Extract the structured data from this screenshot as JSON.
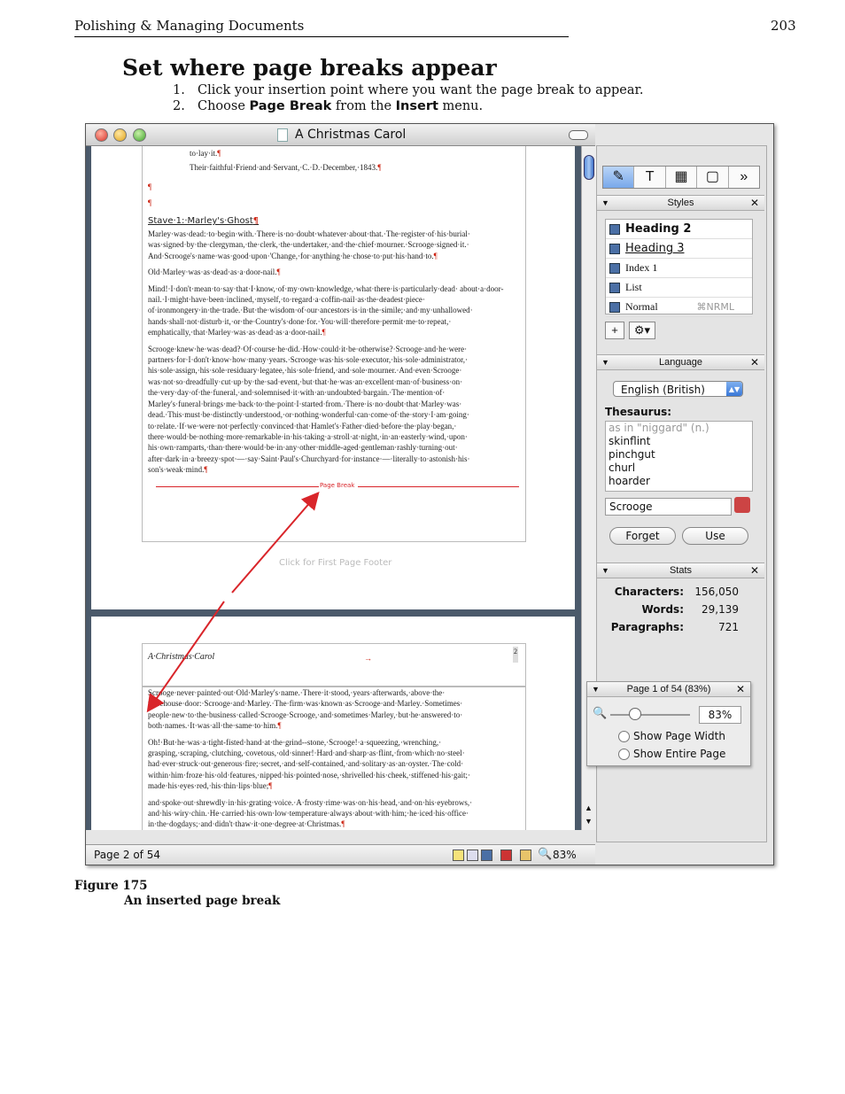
{
  "header": {
    "running_title": "Polishing & Managing Documents",
    "page_number": "203"
  },
  "section": {
    "heading": "Set where page breaks appear",
    "steps": [
      {
        "num": "1.",
        "text": "Click your insertion point where you want the page break to appear."
      },
      {
        "num": "2.",
        "pre": "Choose ",
        "b1": "Page Break",
        "mid": " from the ",
        "b2": "Insert",
        "post": " menu."
      }
    ]
  },
  "window": {
    "title": "A Christmas Carol"
  },
  "document": {
    "page1_top_lines": [
      "to·lay·it.",
      "Their·faithful·Friend·and·Servant,·C.·D.·December,·1843."
    ],
    "pilcrow": "¶",
    "stave_heading": "Stave·1:·Marley's·Ghost",
    "page1_paragraphs": [
      "Marley·was·dead:·to·begin·with.·There·is·no·doubt·whatever·about·that.·The·register·of·his·burial· was·signed·by·the·clergyman,·the·clerk,·the·undertaker,·and·the·chief·mourner.·Scrooge·signed·it.· And·Scrooge's·name·was·good·upon·'Change,·for·anything·he·chose·to·put·his·hand·to.",
      "Old·Marley·was·as·dead·as·a·door-nail.",
      "Mind!·I·don't·mean·to·say·that·I·know,·of·my·own·knowledge,·what·there·is·particularly·dead· about·a·door-nail.·I·might·have·been·inclined,·myself,·to·regard·a·coffin-nail·as·the·deadest·piece· of·ironmongery·in·the·trade.·But·the·wisdom·of·our·ancestors·is·in·the·simile;·and·my·unhallowed· hands·shall·not·disturb·it,·or·the·Country's·done·for.·You·will·therefore·permit·me·to·repeat,· emphatically,·that·Marley·was·as·dead·as·a·door-nail.",
      "Scrooge·knew·he·was·dead?·Of·course·he·did.·How·could·it·be·otherwise?·Scrooge·and·he·were· partners·for·I·don't·know·how·many·years.·Scrooge·was·his·sole·executor,·his·sole·administrator,· his·sole·assign,·his·sole·residuary·legatee,·his·sole·friend,·and·sole·mourner.·And·even·Scrooge· was·not·so·dreadfully·cut·up·by·the·sad·event,·but·that·he·was·an·excellent·man·of·business·on· the·very·day·of·the·funeral,·and·solemnised·it·with·an·undoubted·bargain.·The·mention·of· Marley's·funeral·brings·me·back·to·the·point·I·started·from.·There·is·no·doubt·that·Marley·was· dead.·This·must·be·distinctly·understood,·or·nothing·wonderful·can·come·of·the·story·I·am·going· to·relate.·If·we·were·not·perfectly·convinced·that·Hamlet's·Father·died·before·the·play·began,· there·would·be·nothing·more·remarkable·in·his·taking·a·stroll·at·night,·in·an·easterly·wind,·upon· his·own·ramparts,·than·there·would·be·in·any·other·middle-aged·gentleman·rashly·turning·out· after·dark·in·a·breezy·spot·—·say·Saint·Paul's·Churchyard·for·instance·—·literally·to·astonish·his· son's·weak·mind."
    ],
    "page_break_label": "Page Break",
    "footer_placeholder": "Click for First Page Footer",
    "page2_header": "A·Christmas·Carol",
    "page2_header_tab": "→",
    "page2_header_num": "2",
    "page2_paragraphs": [
      "Scrooge·never·painted·out·Old·Marley's·name.·There·it·stood,·years·afterwards,·above·the· warehouse·door:·Scrooge·and·Marley.·The·firm·was·known·as·Scrooge·and·Marley.·Sometimes· people·new·to·the·business·called·Scrooge·Scrooge,·and·sometimes·Marley,·but·he·answered·to· both·names.·It·was·all·the·same·to·him.",
      "Oh!·But·he·was·a·tight-fisted·hand·at·the·grind--stone,·Scrooge!·a·squeezing,·wrenching,· grasping,·scraping,·clutching,·covetous,·old·sinner!·Hard·and·sharp·as·flint,·from·which·no·steel· had·ever·struck·out·generous·fire;·secret,·and·self-contained,·and·solitary·as·an·oyster.·The·cold· within·him·froze·his·old·features,·nipped·his·pointed·nose,·shrivelled·his·cheek,·stiffened·his·gait;· made·his·eyes·red,·his·thin·lips·blue;",
      "and·spoke·out·shrewdly·in·his·grating·voice.·A·frosty·rime·was·on·his·head,·and·on·his·eyebrows,· and·his·wiry·chin.·He·carried·his·own·low·temperature·always·about·with·him;·he·iced·his·office· in·the·dogdays;·and·didn't·thaw·it·one·degree·at·Christmas."
    ]
  },
  "status_bar": {
    "page": "Page 2 of 54",
    "zoom": "83%"
  },
  "inspector": {
    "tabs": [
      "✎",
      "T",
      "▦",
      "▢",
      "»"
    ],
    "styles": {
      "title": "Styles",
      "items": [
        {
          "label": "Heading 2",
          "shortcut": ""
        },
        {
          "label": "Heading 3",
          "shortcut": ""
        },
        {
          "label": "Index 1",
          "shortcut": ""
        },
        {
          "label": "List",
          "shortcut": ""
        },
        {
          "label": "Normal",
          "shortcut": "⌘NRML"
        }
      ],
      "add_label": "+",
      "gear_label": "⚙▾"
    },
    "language": {
      "title": "Language",
      "selected": "English (British)",
      "thesaurus_label": "Thesaurus:",
      "thesaurus_items": [
        "as in \"niggard\" (n.)",
        "skinflint",
        "pinchgut",
        "churl",
        "hoarder"
      ],
      "lookup_value": "Scrooge",
      "forget_label": "Forget",
      "use_label": "Use"
    },
    "stats": {
      "title": "Stats",
      "rows": [
        {
          "label": "Characters:",
          "value": "156,050"
        },
        {
          "label": "Words:",
          "value": "29,139"
        },
        {
          "label": "Paragraphs:",
          "value": "721"
        }
      ]
    }
  },
  "zoom_panel": {
    "title": "Page 1 of 54 (83%)",
    "zoom_value": "83%",
    "zoom_level": 0.3,
    "option1": "Show Page Width",
    "option2": "Show Entire Page"
  },
  "figure": {
    "label": "Figure 175",
    "caption": "An inserted page break"
  },
  "colors": {
    "accent_red": "#d9252a",
    "doc_gutter": "#4b5a6b"
  }
}
